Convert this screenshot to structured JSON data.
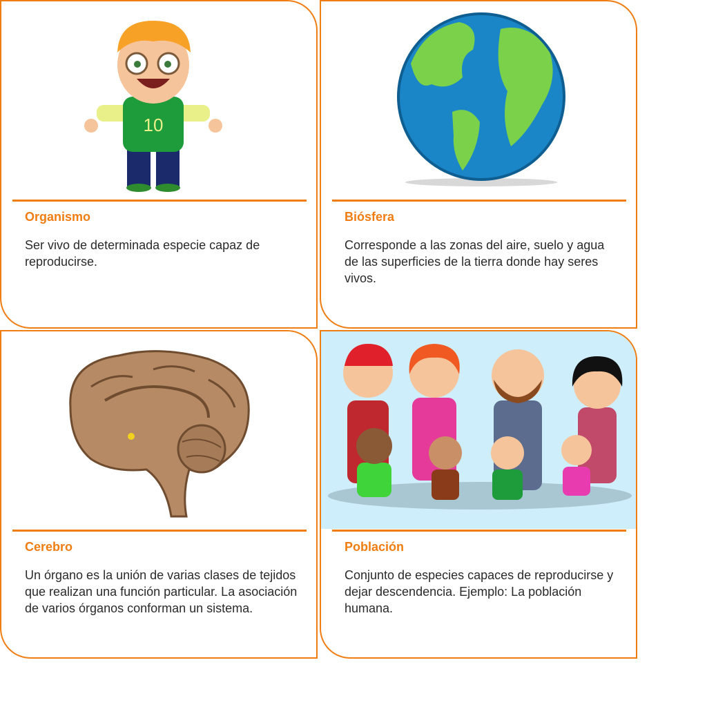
{
  "cards": [
    {
      "title": "Organismo",
      "text": "Ser vivo de determinada especie capaz de reproducirse.",
      "image": "child-illustration"
    },
    {
      "title": "Biósfera",
      "text": "Corresponde a las zonas del aire, suelo y agua de las superficies de la tierra donde hay seres vivos.",
      "image": "earth-globe-illustration"
    },
    {
      "title": "Cerebro",
      "text": "Un órgano es la unión de varias clases de tejidos que realizan una función particular. La asociación de varios órganos conforman un sistema.",
      "image": "brain-illustration"
    },
    {
      "title": "Población",
      "text": "Conjunto de especies capaces de reproducirse y dejar descendencia. Ejemplo: La población humana.",
      "image": "family-illustration"
    }
  ],
  "jersey_number": "10",
  "colors": {
    "accent": "#f07d12",
    "text": "#2a2a2a"
  }
}
